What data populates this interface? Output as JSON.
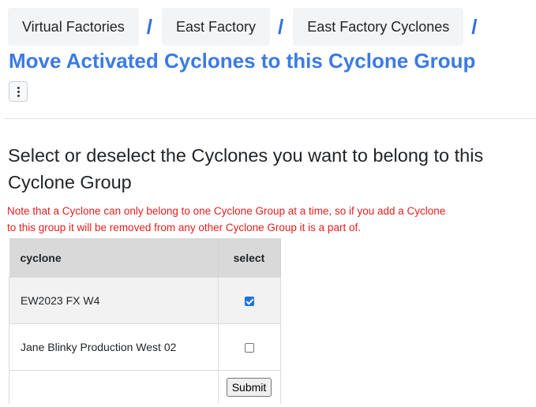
{
  "breadcrumb": {
    "items": [
      {
        "label": "Virtual Factories"
      },
      {
        "label": "East Factory"
      },
      {
        "label": "East Factory Cyclones"
      }
    ],
    "separator": "/"
  },
  "page_title": "Move Activated Cyclones to this Cyclone Group",
  "menu_icon": "vertical-ellipsis-icon",
  "heading": "Select or deselect the Cyclones you want to belong to this Cyclone Group",
  "note": {
    "line1": "Note that a Cyclone can only belong to one Cyclone Group at a time, so if you add a Cyclone",
    "line2": "to this group it will be removed from any other Cyclone Group it is a part of.",
    "color": "#e61d1d"
  },
  "table": {
    "columns": [
      "cyclone",
      "select"
    ],
    "rows": [
      {
        "cyclone": "EW2023 FX W4",
        "selected": true
      },
      {
        "cyclone": "Jane Blinky Production West 02",
        "selected": false
      }
    ],
    "submit_label": "Submit"
  },
  "colors": {
    "title": "#3b7ae6",
    "separator": "#2f6fd9",
    "checkbox_checked": "#1a73e8"
  }
}
